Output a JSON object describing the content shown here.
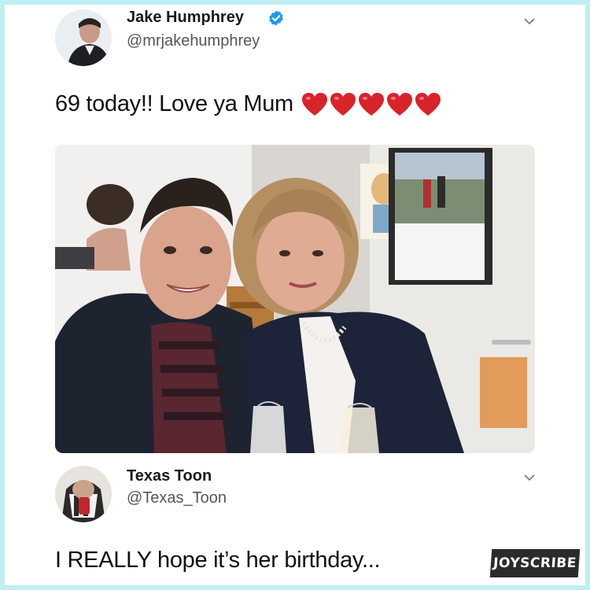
{
  "tweet": {
    "author": "Jake Humphrey",
    "handle": "@mrjakehumphrey",
    "verified": true,
    "text": "69 today!! Love ya Mum",
    "hearts": 5,
    "heart_color": "#d8232a"
  },
  "reply": {
    "author": "Texas Toon",
    "handle": "@Texas_Toon",
    "text": "I REALLY hope it’s her birthday..."
  },
  "watermark": "JOYSCRIBE",
  "colors": {
    "border": "#bfeef4",
    "verified_blue": "#1d9bf0"
  }
}
